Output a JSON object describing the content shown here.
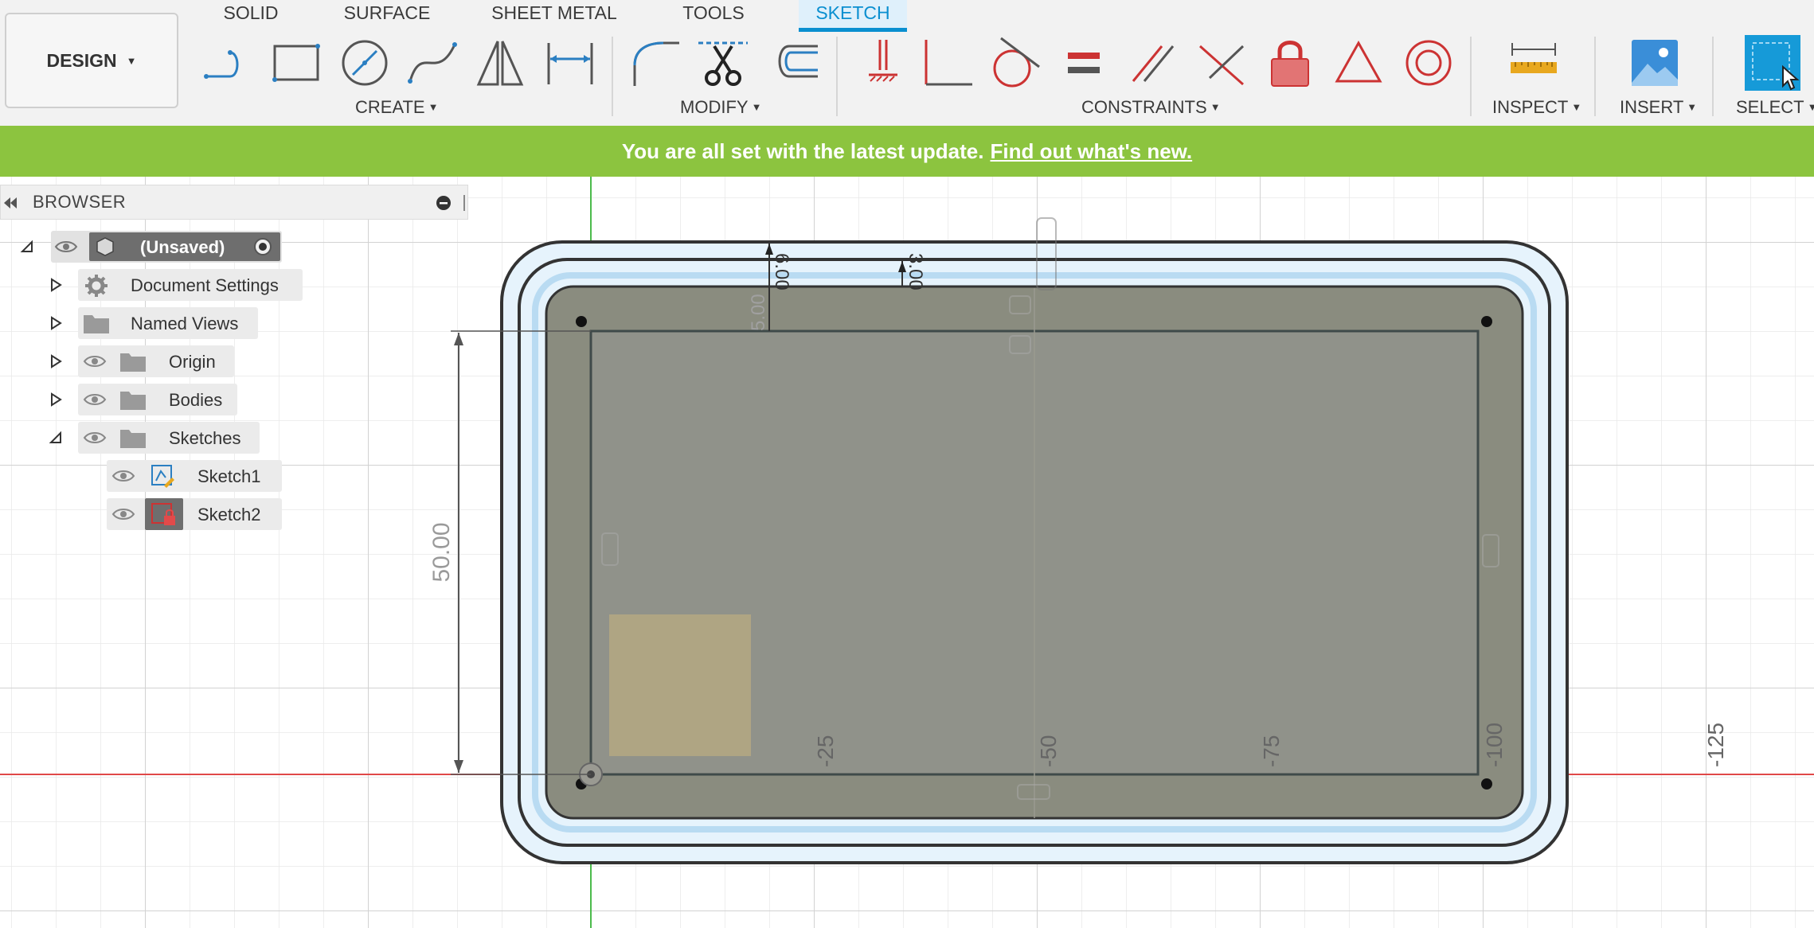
{
  "toolbar": {
    "design_label": "DESIGN",
    "tabs": [
      "SOLID",
      "SURFACE",
      "SHEET METAL",
      "TOOLS",
      "SKETCH"
    ],
    "active_tab": "SKETCH",
    "groups": {
      "create": "CREATE",
      "modify": "MODIFY",
      "constraints": "CONSTRAINTS",
      "inspect": "INSPECT",
      "insert": "INSERT",
      "select": "SELECT"
    },
    "create_tools": [
      "line-icon",
      "rectangle-icon",
      "circle-icon",
      "spline-icon",
      "mirror-icon",
      "dimension-icon"
    ],
    "modify_tools": [
      "fillet-icon",
      "trim-icon",
      "offset-icon"
    ],
    "constraint_tools": [
      "coincident-icon",
      "horizontal-vertical-icon",
      "tangent-icon",
      "equal-icon",
      "parallel-icon",
      "perpendicular-icon",
      "fix-unfix-icon",
      "midpoint-icon",
      "concentric-icon"
    ],
    "inspect_tool": "measure-icon",
    "insert_tool": "insert-image-icon",
    "select_tool": "select-window-icon"
  },
  "banner": {
    "message": "You are all set with the latest update.",
    "link": "Find out what's new."
  },
  "browser": {
    "title": "BROWSER",
    "root": "(Unsaved)",
    "items": [
      {
        "label": "Document Settings",
        "icon": "gear-icon"
      },
      {
        "label": "Named Views",
        "icon": "folder-icon"
      },
      {
        "label": "Origin",
        "icon": "folder-icon"
      },
      {
        "label": "Bodies",
        "icon": "folder-icon"
      },
      {
        "label": "Sketches",
        "icon": "folder-icon"
      }
    ],
    "sketches": [
      {
        "label": "Sketch1",
        "icon": "sketch-edit-icon"
      },
      {
        "label": "Sketch2",
        "icon": "sketch-locked-icon"
      }
    ]
  },
  "canvas": {
    "dimensions": {
      "height": "50.00",
      "top_offset": "5.00",
      "offset_a": "6.00",
      "offset_b": "3.00"
    },
    "axis_ticks": [
      "-25",
      "-50",
      "-75",
      "-100",
      "-125"
    ]
  },
  "colors": {
    "accent": "#0a8fd0",
    "banner": "#8cc43f",
    "body_fill": "#8a8c7f",
    "x_axis": "#e04848",
    "y_axis": "#4cbb4c"
  }
}
